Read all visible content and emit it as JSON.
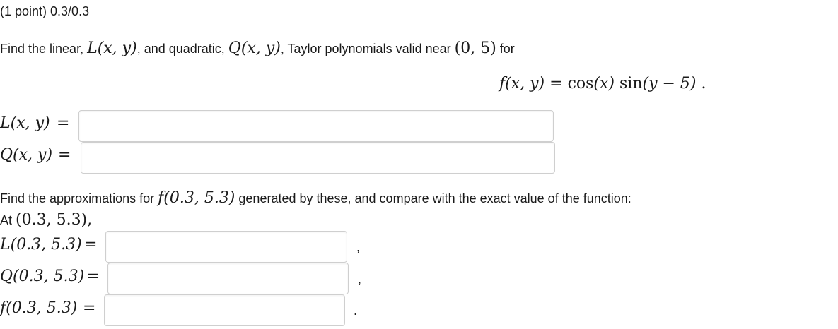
{
  "header": {
    "points_label": "(1 point) 0.3/0.3"
  },
  "question": {
    "intro_prefix": "Find the linear, ",
    "L": "L",
    "Q": "Q",
    "args_xy": "(x, y)",
    "and": ", and quadratic, ",
    "intro_suffix": ", Taylor polynomials valid near ",
    "point": "(0, 5)",
    "for": " for",
    "function_lhs": "f(x, y)",
    "equals": " = ",
    "cos": "cos",
    "cos_arg": "(x)",
    "sin": " sin",
    "sin_arg": "(y − 5)",
    "period": " ."
  },
  "inputs": {
    "L_label": "L(x, y)",
    "Q_label": "Q(x, y)",
    "L_value": "",
    "Q_value": ""
  },
  "approx": {
    "text_prefix": "Find the approximations for ",
    "f_at": "f(0.3, 5.3)",
    "text_suffix": " generated by these, and compare with the exact value of the function:",
    "at_prefix": "At ",
    "at_point": "(0.3, 5.3),",
    "L_label": "L(0.3, 5.3)",
    "Q_label": "Q(0.3, 5.3)",
    "f_label": "f(0.3, 5.3)",
    "comma": ",",
    "period": ".",
    "L_value": "",
    "Q_value": "",
    "f_value": ""
  },
  "eq_sign": "="
}
